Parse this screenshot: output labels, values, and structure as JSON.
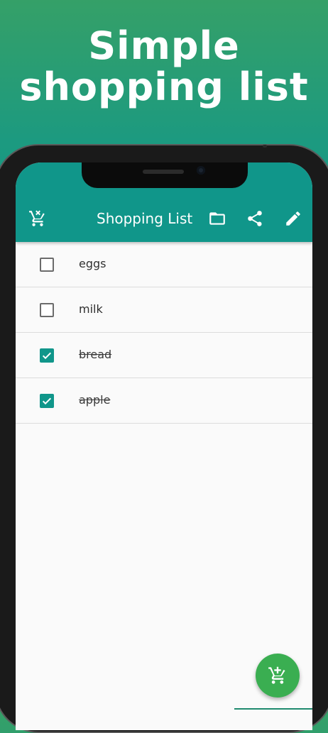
{
  "promo": {
    "headline_line1": "Simple",
    "headline_line2": "shopping list"
  },
  "appbar": {
    "title": "Shopping List",
    "icons": [
      "cart-remove-icon",
      "folder-icon",
      "share-icon",
      "edit-icon"
    ],
    "color": "#10968a"
  },
  "items": [
    {
      "label": "eggs",
      "checked": false
    },
    {
      "label": "milk",
      "checked": false
    },
    {
      "label": "bread",
      "checked": true
    },
    {
      "label": "apple",
      "checked": true
    }
  ],
  "fab": {
    "icon": "cart-add-icon",
    "color": "#3aae51"
  },
  "colors": {
    "accent": "#10968a",
    "background_top": "#35a068",
    "background_bottom": "#12907f"
  }
}
